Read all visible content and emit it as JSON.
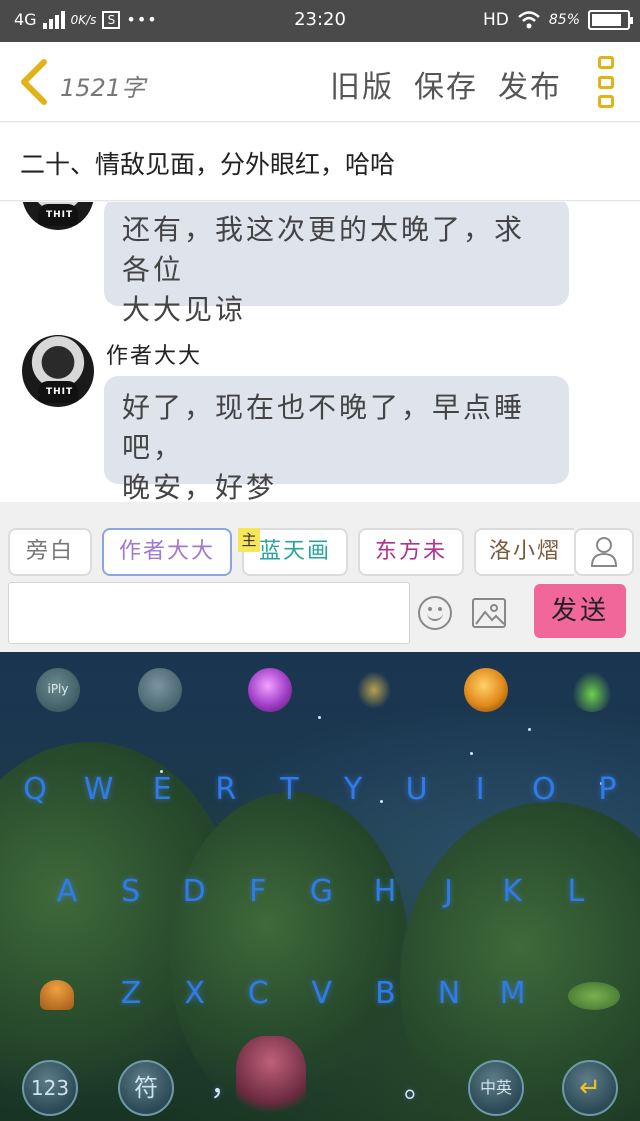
{
  "status_bar": {
    "network": "4G",
    "speed": "0K/s",
    "time": "23:20",
    "hd": "HD",
    "battery_pct": "85%",
    "battery_level": 0.85
  },
  "nav": {
    "word_count": "1521字",
    "actions": [
      "旧版",
      "保存",
      "发布"
    ]
  },
  "chapter_title": "二十、情敌见面，分外眼红，哈哈",
  "messages": [
    {
      "sender": "",
      "text_lines": [
        "还有，我这次更的太晚了，求各位",
        "大大见谅"
      ]
    },
    {
      "sender": "作者大大",
      "text_lines": [
        "好了，现在也不晚了，早点睡吧，",
        "晚安，好梦"
      ]
    }
  ],
  "roles": [
    {
      "label": "旁白",
      "color": "#777777",
      "selected": false
    },
    {
      "label": "作者大大",
      "color": "#a07ad0",
      "selected": true
    },
    {
      "label": "蓝天画",
      "color": "#26a69a",
      "selected": false,
      "badge": "主"
    },
    {
      "label": "东方未",
      "color": "#b0338f",
      "selected": false
    },
    {
      "label": "洛小熠",
      "color": "#7a5a3a",
      "selected": false
    }
  ],
  "composer": {
    "input_value": "",
    "send_label": "发送"
  },
  "keyboard": {
    "toolbar": [
      "iFly-icon",
      "dice-icon",
      "orb-icon",
      "dragonfly-icon",
      "apple-icon",
      "sprout-icon"
    ],
    "row1": [
      "Q",
      "W",
      "E",
      "R",
      "T",
      "Y",
      "U",
      "I",
      "O",
      "P"
    ],
    "row2": [
      "A",
      "S",
      "D",
      "F",
      "G",
      "H",
      "J",
      "K",
      "L"
    ],
    "row3": [
      "Z",
      "X",
      "C",
      "V",
      "B",
      "N",
      "M"
    ],
    "bottom": {
      "num_label": "123",
      "symbol_label": "符",
      "comma_label": "，",
      "period_label": "。",
      "lang_label": "中英",
      "enter_label": "↵"
    },
    "iply_label": "iPly"
  }
}
